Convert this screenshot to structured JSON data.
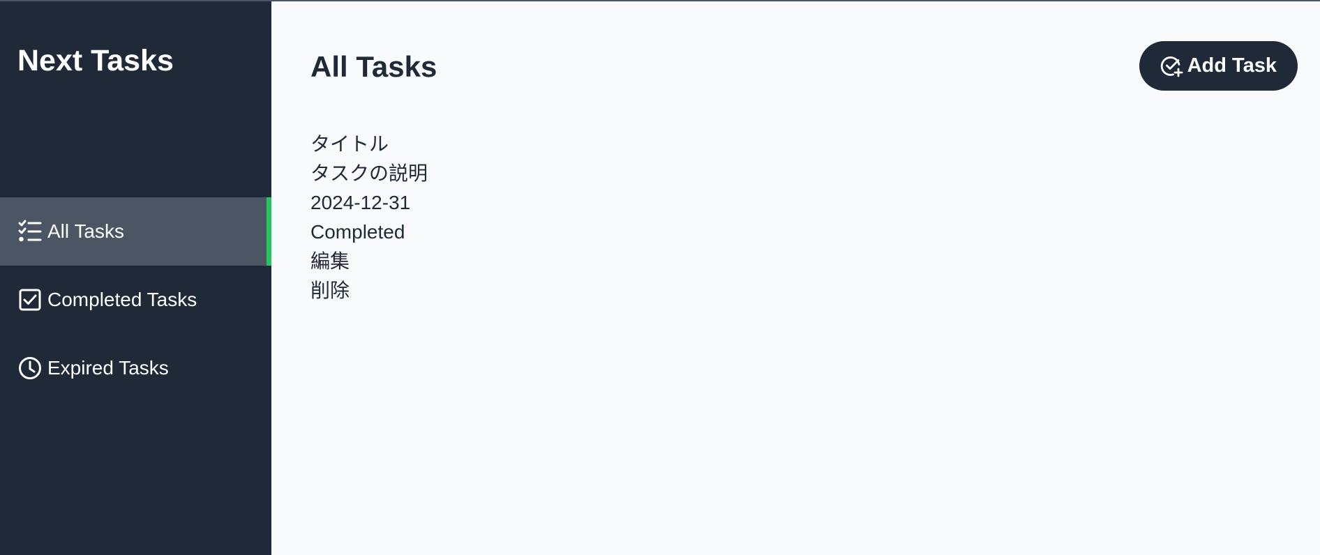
{
  "sidebar": {
    "title": "Next Tasks",
    "items": [
      {
        "label": "All Tasks",
        "icon": "list-check-icon",
        "active": true
      },
      {
        "label": "Completed Tasks",
        "icon": "checkbox-icon",
        "active": false
      },
      {
        "label": "Expired Tasks",
        "icon": "clock-icon",
        "active": false
      }
    ]
  },
  "main": {
    "title": "All Tasks",
    "add_button_label": "Add Task",
    "add_button_icon": "circle-check-plus-icon",
    "tasks": [
      {
        "title": "タイトル",
        "description": "タスクの説明",
        "due_date": "2024-12-31",
        "status": "Completed",
        "edit_label": "編集",
        "delete_label": "削除"
      }
    ]
  },
  "colors": {
    "sidebar_bg": "#1f2937",
    "active_item_bg": "#4b5563",
    "active_indicator": "#22c55e",
    "main_bg": "#f8fafc",
    "text_dark": "#1f2937"
  }
}
